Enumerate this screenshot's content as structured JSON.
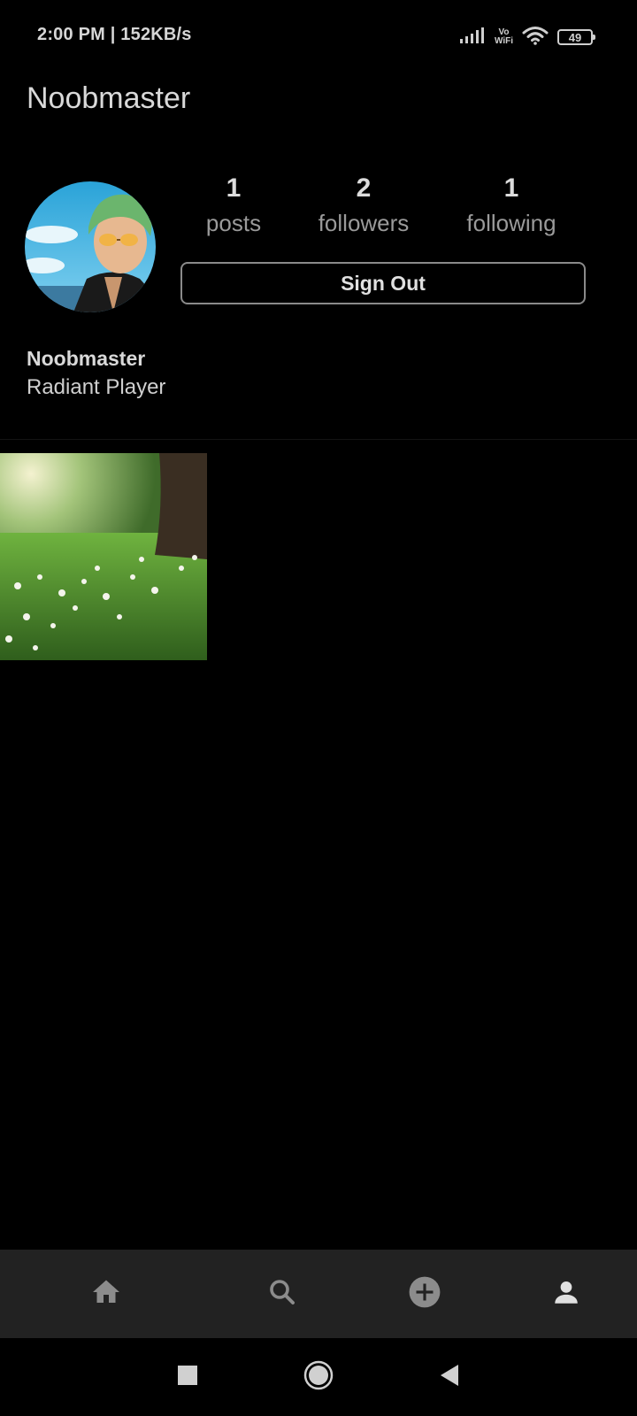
{
  "status_bar": {
    "time_speed": "2:00 PM | 152KB/s",
    "vowifi_top": "Vo",
    "vowifi_bottom": "WiFi",
    "battery": "49",
    "icons": [
      "signal-icon",
      "vowifi-icon",
      "wifi-icon",
      "battery-icon"
    ]
  },
  "header": {
    "title": "Noobmaster"
  },
  "profile": {
    "stats": [
      {
        "value": "1",
        "label": "posts"
      },
      {
        "value": "2",
        "label": "followers"
      },
      {
        "value": "1",
        "label": "following"
      }
    ],
    "sign_out_label": "Sign Out",
    "display_name": "Noobmaster",
    "bio": "Radiant Player"
  },
  "posts": {
    "count": 1
  },
  "bottom_nav": {
    "items": [
      "home-icon",
      "search-icon",
      "add-post-icon",
      "profile-icon"
    ],
    "active": "profile-icon"
  },
  "system_nav": {
    "items": [
      "recents-icon",
      "home-icon",
      "back-icon"
    ]
  },
  "colors": {
    "background": "#000000",
    "nav_background": "#222222",
    "primary_text": "#d9d9d9",
    "secondary_text": "#9a9a9a",
    "button_border": "#8a8a8a",
    "nav_icon_inactive": "#8c8c8c",
    "nav_icon_active": "#e0e0e0"
  }
}
